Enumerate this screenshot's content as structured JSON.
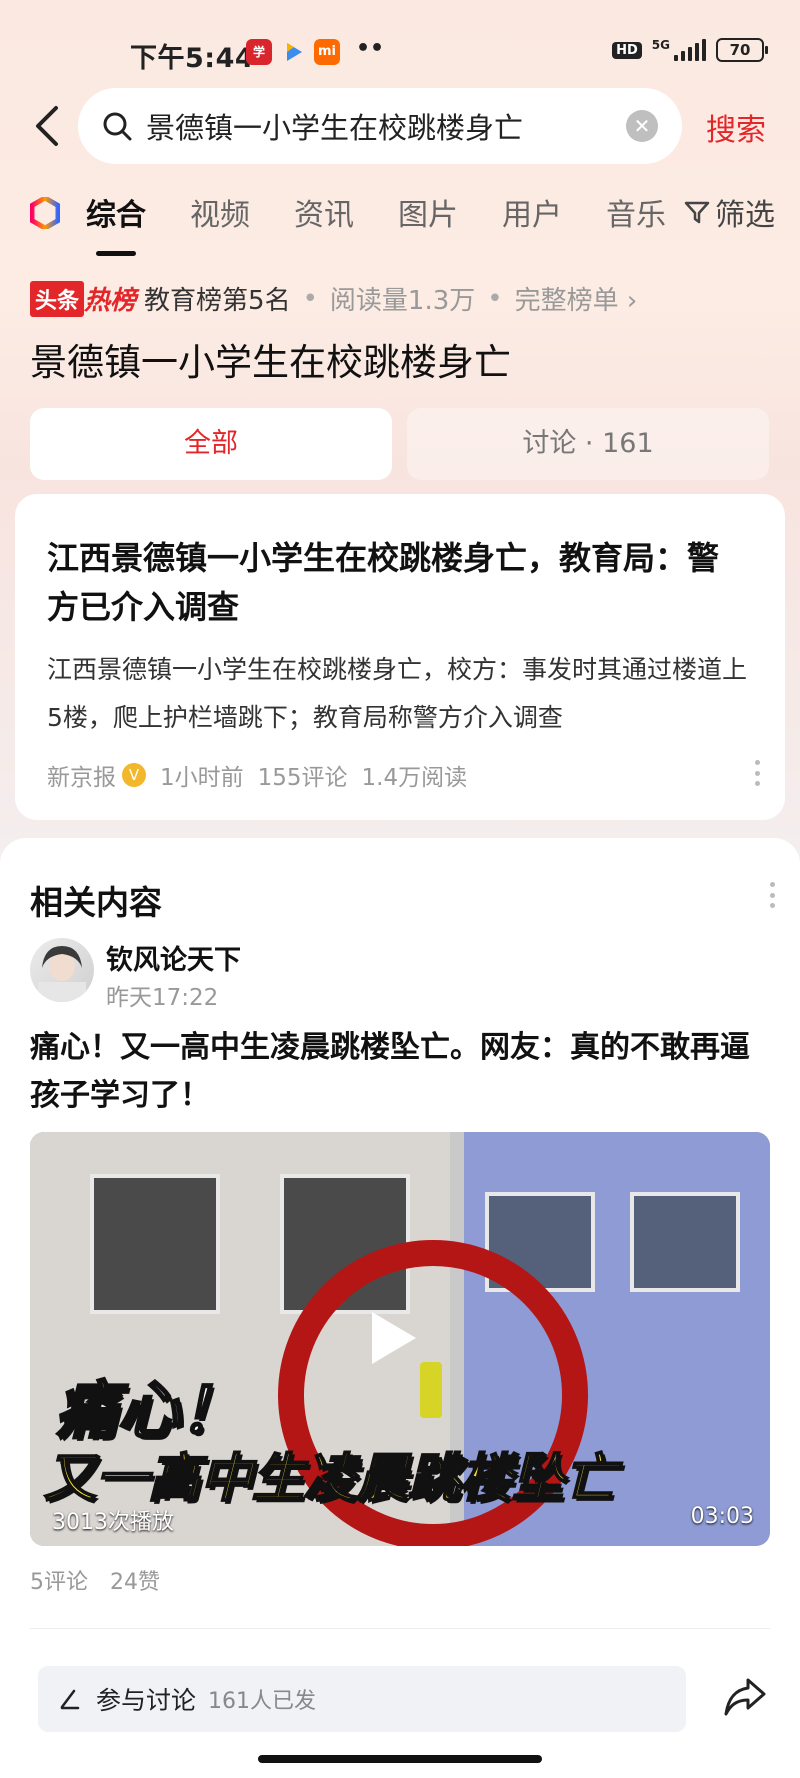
{
  "status_bar": {
    "time": "下午5:44",
    "apps": [
      "学习强国",
      "视频",
      "mi"
    ],
    "more": "••",
    "hd": "HD",
    "network": "5G",
    "battery": "70"
  },
  "search": {
    "back": "back-icon",
    "query": "景德镇一小学生在校跳楼身亡",
    "search_label": "搜索"
  },
  "tabs": [
    "综合",
    "视频",
    "资讯",
    "图片",
    "用户",
    "音乐"
  ],
  "filter_label": "筛选",
  "hot_rank": {
    "source_badge": "头条",
    "rank_badge": "热榜",
    "rank_text": "教育榜第5名",
    "reads": "阅读量1.3万",
    "full_list": "完整榜单 ›"
  },
  "topic_title": "景德镇一小学生在校跳楼身亡",
  "segments": {
    "all": "全部",
    "discussion": "讨论 · 161"
  },
  "news_card": {
    "title": "江西景德镇一小学生在校跳楼身亡，教育局：警方已介入调查",
    "summary": "江西景德镇一小学生在校跳楼身亡，校方：事发时其通过楼道上5楼，爬上护栏墙跳下；教育局称警方介入调查",
    "source": "新京报",
    "time": "1小时前",
    "comments": "155评论",
    "reads": "1.4万阅读"
  },
  "related": {
    "title": "相关内容",
    "author": "钦风论天下",
    "post_time": "昨天17:22",
    "post_title": "痛心！又一高中生凌晨跳楼坠亡。网友：真的不敢再逼孩子学习了！",
    "video": {
      "caption_line1": "痛心！",
      "caption_line2": "又一高中生凌晨跳楼坠亡",
      "views": "3013次播放",
      "duration": "03:03"
    },
    "stats": "5评论　24赞"
  },
  "bottom_bar": {
    "comment_label": "参与讨论",
    "comment_count": "161人已发"
  },
  "colors": {
    "accent": "#e3262a",
    "badge_gold": "#f2b72a"
  }
}
